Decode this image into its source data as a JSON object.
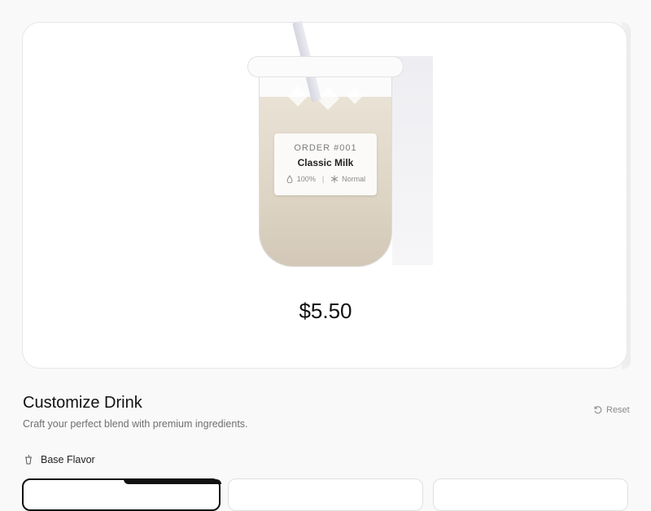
{
  "preview": {
    "order_number": "ORDER #001",
    "drink_name": "Classic Milk",
    "sweetness": "100%",
    "ice_level": "Normal",
    "price": "$5.50"
  },
  "customize": {
    "title": "Customize Drink",
    "subtitle": "Craft your perfect blend with premium ingredients.",
    "reset_label": "Reset"
  },
  "base_flavor": {
    "label": "Base Flavor",
    "selected_index": 0
  },
  "icons": {
    "sweetness": "drop-icon",
    "ice": "snowflake-icon",
    "reset": "rotate-ccw-icon",
    "base_flavor": "cup-icon"
  },
  "colors": {
    "milk": "#ddd4c4",
    "accent": "#111111",
    "muted_text": "#6f6f6f"
  }
}
